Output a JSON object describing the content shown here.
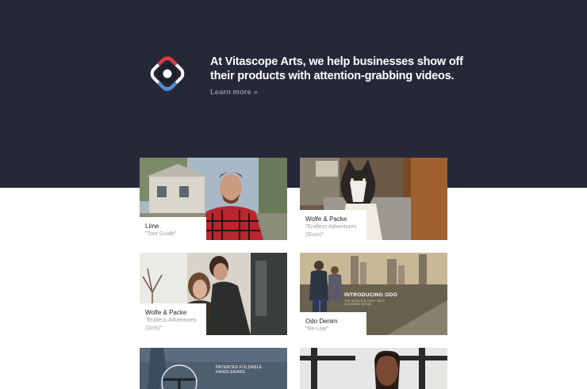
{
  "hero": {
    "tagline": "At Vitascope Arts, we help businesses show off their products with attention-grabbing videos.",
    "learn_more": "Learn more »"
  },
  "portfolio": [
    {
      "client": "Lime",
      "title": "\"Tour Guide\""
    },
    {
      "client": "Wolfe & Packe",
      "title": "\"Endless Adventures (Guys)\""
    },
    {
      "client": "Wolfe & Packe",
      "title": "\"Endless Adventures (Girls)\""
    },
    {
      "client": "Odo Denim",
      "title": "\"Re-Live\"",
      "overlay_title": "INTRODUCING ODO",
      "overlay_sub": "THE WORLD'S FIRST SELF-CLEANING DENIM"
    },
    {
      "overlay_title": "PATENTED FOLDABLE HANDLEBARS"
    },
    {}
  ],
  "colors": {
    "hero_bg": "#262838",
    "logo_red": "#e8363c",
    "logo_blue": "#4d8fd9"
  }
}
